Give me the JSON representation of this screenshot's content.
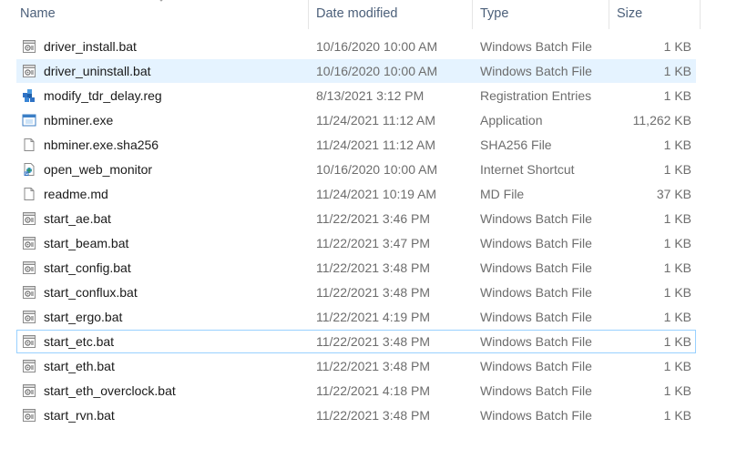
{
  "columns": {
    "name": "Name",
    "date": "Date modified",
    "type": "Type",
    "size": "Size"
  },
  "files": [
    {
      "name": "driver_install.bat",
      "date": "10/16/2020 10:00 AM",
      "type": "Windows Batch File",
      "size": "1 KB",
      "icon": "batch-file-icon"
    },
    {
      "name": "driver_uninstall.bat",
      "date": "10/16/2020 10:00 AM",
      "type": "Windows Batch File",
      "size": "1 KB",
      "icon": "batch-file-icon"
    },
    {
      "name": "modify_tdr_delay.reg",
      "date": "8/13/2021 3:12 PM",
      "type": "Registration Entries",
      "size": "1 KB",
      "icon": "registry-file-icon"
    },
    {
      "name": "nbminer.exe",
      "date": "11/24/2021 11:12 AM",
      "type": "Application",
      "size": "11,262 KB",
      "icon": "application-icon"
    },
    {
      "name": "nbminer.exe.sha256",
      "date": "11/24/2021 11:12 AM",
      "type": "SHA256 File",
      "size": "1 KB",
      "icon": "generic-file-icon"
    },
    {
      "name": "open_web_monitor",
      "date": "10/16/2020 10:00 AM",
      "type": "Internet Shortcut",
      "size": "1 KB",
      "icon": "internet-shortcut-icon"
    },
    {
      "name": "readme.md",
      "date": "11/24/2021 10:19 AM",
      "type": "MD File",
      "size": "37 KB",
      "icon": "generic-file-icon"
    },
    {
      "name": "start_ae.bat",
      "date": "11/22/2021 3:46 PM",
      "type": "Windows Batch File",
      "size": "1 KB",
      "icon": "batch-file-icon"
    },
    {
      "name": "start_beam.bat",
      "date": "11/22/2021 3:47 PM",
      "type": "Windows Batch File",
      "size": "1 KB",
      "icon": "batch-file-icon"
    },
    {
      "name": "start_config.bat",
      "date": "11/22/2021 3:48 PM",
      "type": "Windows Batch File",
      "size": "1 KB",
      "icon": "batch-file-icon"
    },
    {
      "name": "start_conflux.bat",
      "date": "11/22/2021 3:48 PM",
      "type": "Windows Batch File",
      "size": "1 KB",
      "icon": "batch-file-icon"
    },
    {
      "name": "start_ergo.bat",
      "date": "11/22/2021 4:19 PM",
      "type": "Windows Batch File",
      "size": "1 KB",
      "icon": "batch-file-icon"
    },
    {
      "name": "start_etc.bat",
      "date": "11/22/2021 3:48 PM",
      "type": "Windows Batch File",
      "size": "1 KB",
      "icon": "batch-file-icon"
    },
    {
      "name": "start_eth.bat",
      "date": "11/22/2021 3:48 PM",
      "type": "Windows Batch File",
      "size": "1 KB",
      "icon": "batch-file-icon"
    },
    {
      "name": "start_eth_overclock.bat",
      "date": "11/22/2021 4:18 PM",
      "type": "Windows Batch File",
      "size": "1 KB",
      "icon": "batch-file-icon"
    },
    {
      "name": "start_rvn.bat",
      "date": "11/22/2021 3:48 PM",
      "type": "Windows Batch File",
      "size": "1 KB",
      "icon": "batch-file-icon"
    }
  ],
  "selected_index": 1,
  "focused_index": 12,
  "colors": {
    "selection": "#e5f3ff",
    "focus_border": "#99d1ff",
    "header_text": "#4c607a"
  }
}
